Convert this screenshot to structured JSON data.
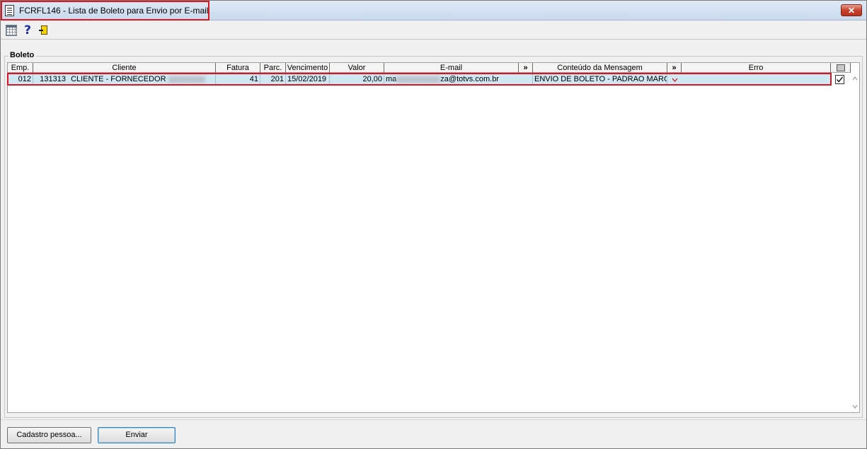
{
  "window": {
    "title": "FCRFL146 - Lista de Boleto para Envio por E-mail",
    "close_label": "✕",
    "accent_color": "#e0141e"
  },
  "toolbar": {
    "grid_icon": "grid-icon",
    "help_icon": "?",
    "exit_icon": "exit-door-icon"
  },
  "group": {
    "label": "Boleto"
  },
  "grid": {
    "columns": [
      {
        "label": "Emp."
      },
      {
        "label": "Cliente"
      },
      {
        "label": "Fatura"
      },
      {
        "label": "Parc."
      },
      {
        "label": "Vencimento"
      },
      {
        "label": "Valor"
      },
      {
        "label": "E-mail"
      },
      {
        "label": "»"
      },
      {
        "label": "Conteúdo da Mensagem"
      },
      {
        "label": "»"
      },
      {
        "label": "Erro"
      }
    ],
    "rows": [
      {
        "emp": "012",
        "cliente_codigo": "131313",
        "cliente_nome": "CLIENTE - FORNECEDOR",
        "fatura": "41",
        "parc": "201",
        "vencimento": "15/02/2019",
        "valor": "20,00",
        "email_prefix": "ma",
        "email_suffix": "za@totvs.com.br",
        "conteudo": "ENVIO DE BOLETO - PADRAO MARCEL",
        "erro": "",
        "checked": true
      }
    ]
  },
  "buttons": {
    "cadastro": "Cadastro pessoa...",
    "enviar": "Enviar"
  }
}
